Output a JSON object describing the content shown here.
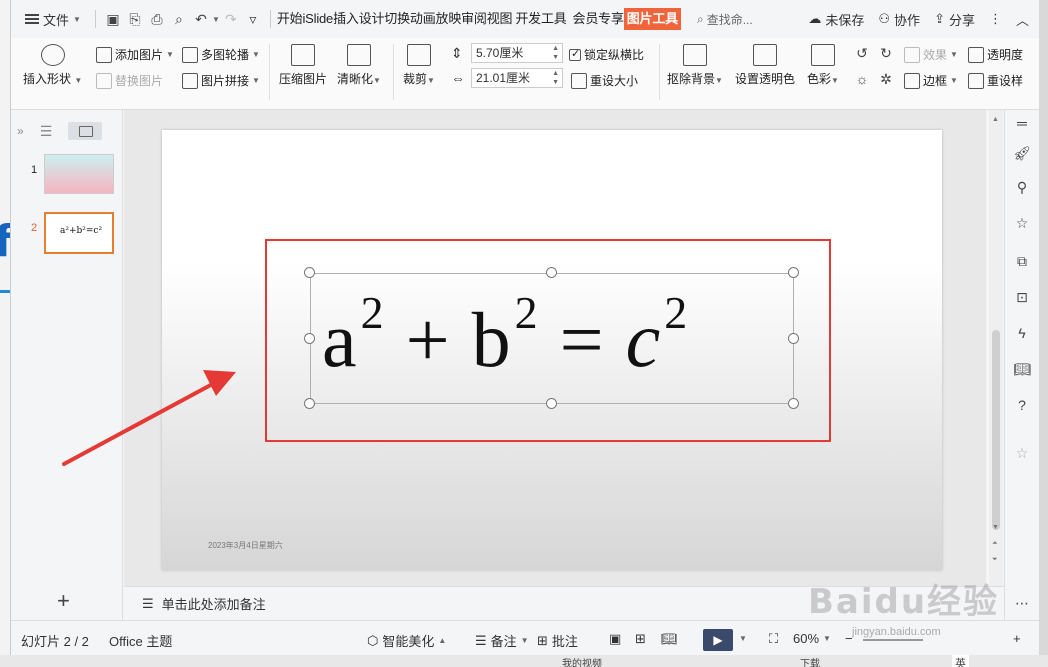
{
  "menubar": {
    "file_label": "文件",
    "tabs": [
      "开始",
      "iSlide",
      "插入",
      "设计",
      "切换",
      "动画",
      "放映",
      "审阅",
      "视图",
      "开发工具",
      "会员专享"
    ],
    "active_tab": "图片工具",
    "search_placeholder": "查找命...",
    "unsaved_label": "未保存",
    "collab_label": "协作",
    "share_label": "分享"
  },
  "ribbon": {
    "insert_shape": "插入形状",
    "add_picture": "添加图片",
    "replace_picture": "替换图片",
    "multi_carousel": "多图轮播",
    "picture_collage": "图片拼接",
    "compress_picture": "压缩图片",
    "sharpen": "清晰化",
    "crop": "裁剪",
    "height_value": "5.70厘米",
    "width_value": "21.01厘米",
    "lock_ratio": "锁定纵横比",
    "reset_size": "重设大小",
    "remove_bg": "抠除背景",
    "set_transparent": "设置透明色",
    "color": "色彩",
    "effects": "效果",
    "border": "边框",
    "transparency": "透明度",
    "reset_style": "重设样"
  },
  "slides": {
    "thumb_numbers": [
      "1",
      "2"
    ],
    "mini_equation": "a²+b²=c²"
  },
  "slide": {
    "date": "2023年3月4日星期六",
    "eq_a": "a",
    "eq_exp1": "2",
    "eq_plus": "+",
    "eq_b": "b",
    "eq_exp2": "2",
    "eq_equals": "=",
    "eq_c": "c",
    "eq_exp3": "2"
  },
  "notes": {
    "placeholder": "单击此处添加备注"
  },
  "status": {
    "slide_counter": "幻灯片 2 / 2",
    "theme": "Office 主题",
    "smart_beautify": "智能美化",
    "notes": "备注",
    "comments": "批注",
    "zoom": "60%"
  },
  "taskbar": {
    "item1": "我的视频",
    "item2": "下载",
    "ime": "英"
  },
  "watermark": {
    "brand": "Baidu经验",
    "sub": "jingyan.baidu.com"
  },
  "colors": {
    "accent_tab": "#f0643c",
    "annotation_red": "#e53935",
    "thumb_active": "#e67e30"
  }
}
